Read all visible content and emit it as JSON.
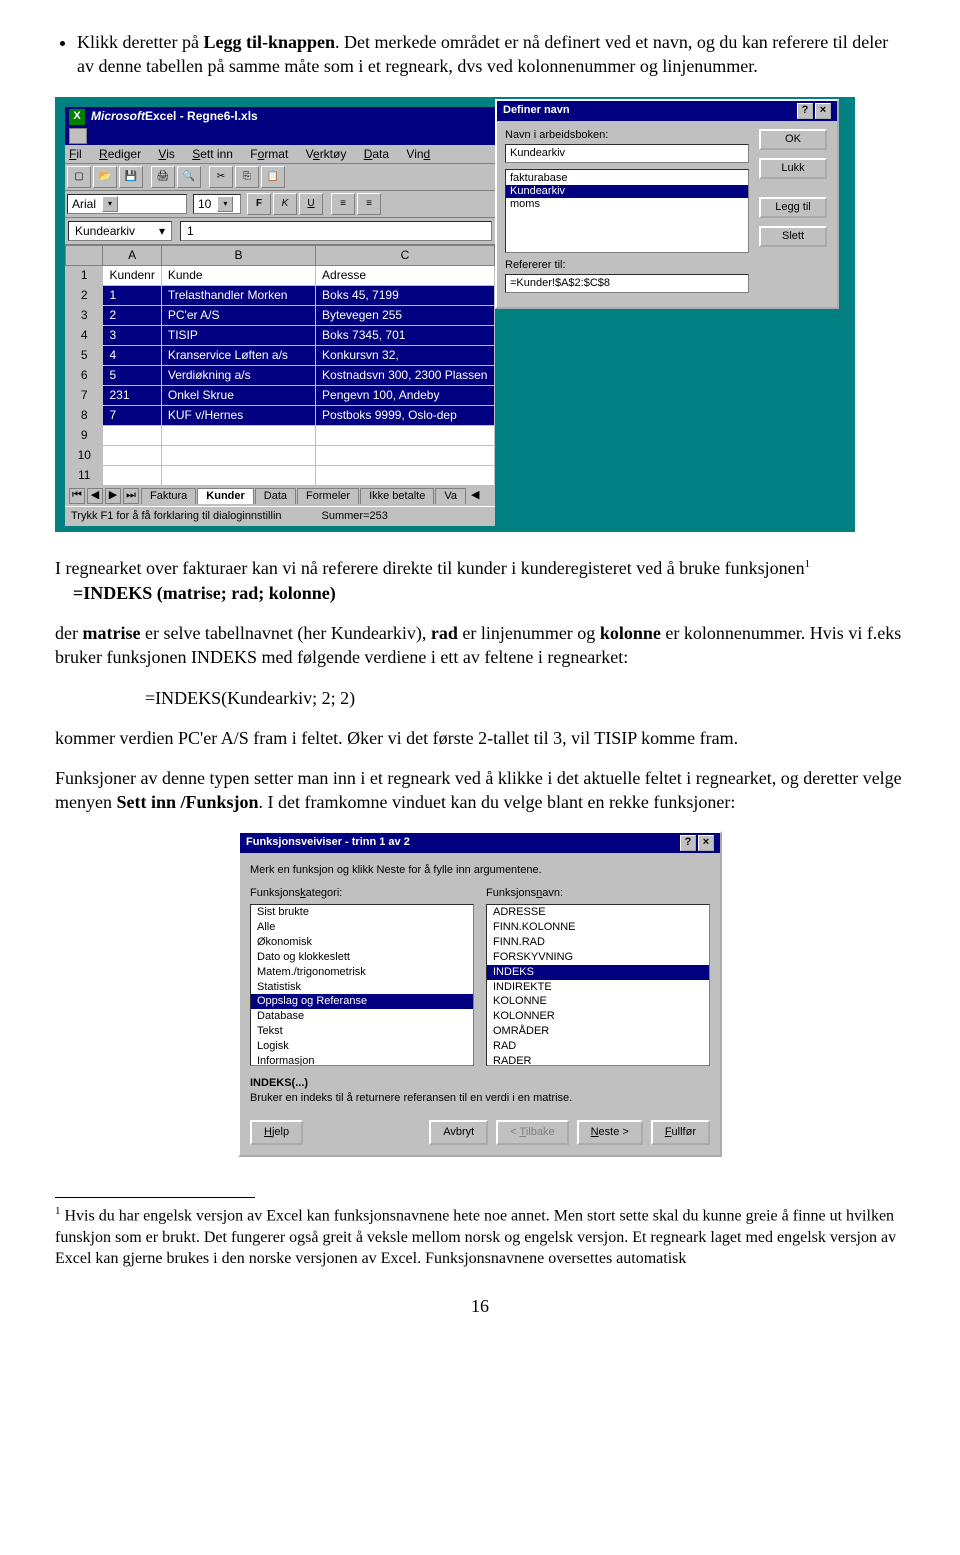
{
  "bullet": {
    "pre": "Klikk deretter på ",
    "bold": "Legg til-knappen",
    "rest": ". Det merkede området er nå definert ved et navn, og du kan referere til deler av denne tabellen på samme måte som i et regneark, dvs ved kolonnenummer og linjenummer."
  },
  "excel": {
    "title_prefix": "Microsoft",
    "title_rest": " Excel - Regne6-l.xls",
    "menu": [
      "Fil",
      "Rediger",
      "Vis",
      "Sett inn",
      "Format",
      "Verktøy",
      "Data",
      "Vind"
    ],
    "font": "Arial",
    "size": "10",
    "fmt_buttons": [
      "F",
      "K",
      "U"
    ],
    "namebox": "Kundearkiv",
    "formula": "1",
    "cols": [
      "A",
      "B",
      "C"
    ],
    "rows": [
      {
        "n": "1",
        "a": "Kundenr",
        "b": "Kunde",
        "c": "Adresse"
      },
      {
        "n": "2",
        "a": "1",
        "b": "Trelasthandler Morken",
        "c": "Boks 45, 7199"
      },
      {
        "n": "3",
        "a": "2",
        "b": "PC'er A/S",
        "c": "Bytevegen 255"
      },
      {
        "n": "4",
        "a": "3",
        "b": "TISIP",
        "c": "Boks 7345, 701"
      },
      {
        "n": "5",
        "a": "4",
        "b": "Kranservice Løften a/s",
        "c": "Konkursvn 32,"
      },
      {
        "n": "6",
        "a": "5",
        "b": "Verdiøkning a/s",
        "c": "Kostnadsvn 300, 2300 Plassen"
      },
      {
        "n": "7",
        "a": "231",
        "b": "Onkel Skrue",
        "c": "Pengevn 100, Andeby"
      },
      {
        "n": "8",
        "a": "7",
        "b": "KUF v/Hernes",
        "c": "Postboks 9999, Oslo-dep"
      }
    ],
    "empty_rows": [
      "9",
      "10",
      "11"
    ],
    "tabs": [
      "Faktura",
      "Kunder",
      "Data",
      "Formeler",
      "Ikke betalte",
      "Va"
    ],
    "status_left": "Trykk F1 for å få forklaring til dialoginnstillin",
    "status_right": "Summer=253"
  },
  "definer": {
    "title": "Definer navn",
    "help_q": "?",
    "close_x": "×",
    "label1": "Navn i arbeidsboken:",
    "value1": "Kundearkiv",
    "list": [
      "fakturabase",
      "Kundearkiv",
      "moms"
    ],
    "label2": "Refererer til:",
    "value2": "=Kunder!$A$2:$C$8",
    "btn_ok": "OK",
    "btn_close": "Lukk",
    "btn_add": "Legg til",
    "btn_del": "Slett"
  },
  "para1": {
    "t1": "I regnearket over fakturaer kan vi nå referere direkte til kunder i kunderegisteret ved å bruke funksjonen",
    "sup": "1",
    "formula": "=INDEKS (matrise; rad; kolonne)"
  },
  "para2": {
    "a": "der ",
    "b1": "matrise",
    "c": " er selve tabellnavnet (her Kundearkiv),  ",
    "b2": "rad",
    "d": " er linjenummer og ",
    "b3": "kolonne",
    "e": "  er kolonnenummer. Hvis vi f.eks bruker funksjonen INDEKS med følgende verdiene i ett av feltene i regnearket:"
  },
  "formula_line": "=INDEKS(Kundearkiv; 2; 2)",
  "para3": "kommer verdien PC'er A/S fram i feltet. Øker vi det første 2-tallet til 3,  vil TISIP komme fram.",
  "para4": {
    "a": "Funksjoner av denne typen setter man inn i et regneark ved å klikke i det aktuelle feltet i regnearket, og deretter velge menyen ",
    "b": "Sett inn /Funksjon",
    "c": ". I det framkomne vinduet kan du velge blant en rekke funksjoner:"
  },
  "wiz": {
    "title": "Funksjonsveiviser - trinn 1 av 2",
    "intro": "Merk en funksjon og klikk Neste for å fylle inn argumentene.",
    "lab_left": "Funksjonskategori:",
    "lab_right": "Funksjonsnavn:",
    "left": [
      "Sist brukte",
      "Alle",
      "Økonomisk",
      "Dato og klokkeslett",
      "Matem./trigonometrisk",
      "Statistisk",
      "Oppslag og Referanse",
      "Database",
      "Tekst",
      "Logisk",
      "Informasjon"
    ],
    "right": [
      "ADRESSE",
      "FINN.KOLONNE",
      "FINN.RAD",
      "FORSKYVNING",
      "INDEKS",
      "INDIREKTE",
      "KOLONNE",
      "KOLONNER",
      "OMRÅDER",
      "RAD",
      "RADER"
    ],
    "sig": "INDEKS(...)",
    "desc": "Bruker en indeks til å returnere referansen til en verdi i en matrise.",
    "btn_help": "Hjelp",
    "btn_cancel": "Avbryt",
    "btn_back": "< Tilbake",
    "btn_next": "Neste >",
    "btn_finish": "Fullfør"
  },
  "footnote": {
    "sup": "1",
    "text": " Hvis du har engelsk versjon av Excel kan funksjonsnavnene hete noe annet. Men stort sette skal du kunne greie å finne ut hvilken funskjon som er brukt. Det fungerer også greit å veksle mellom norsk og engelsk versjon. Et regneark laget med engelsk versjon av Excel kan gjerne brukes i den norske versjonen av Excel. Funksjonsnavnene oversettes automatisk"
  },
  "pagenum": "16"
}
